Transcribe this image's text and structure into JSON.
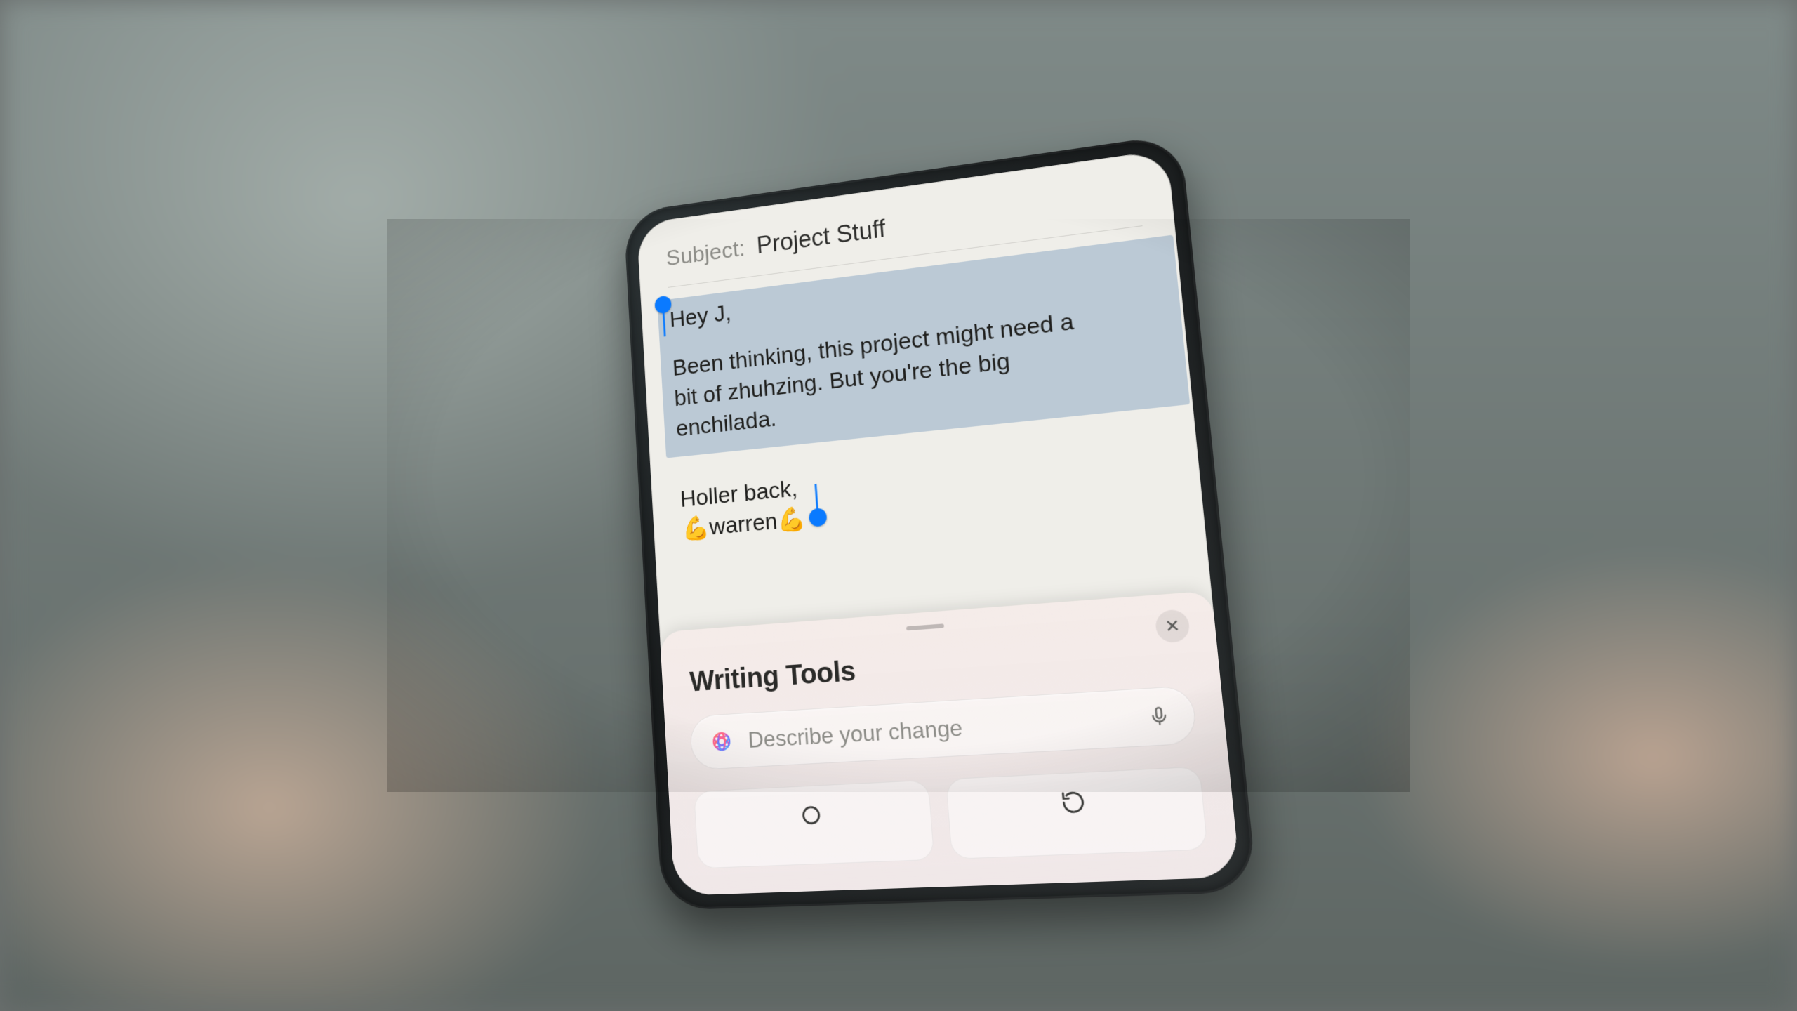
{
  "compose": {
    "subject_label": "Subject:",
    "subject_value": "Project Stuff",
    "greeting": "Hey J,",
    "paragraph": "Been thinking, this project might need a bit of zhuhzing. But you're the big enchilada.",
    "signoff": "Holler back,",
    "signature": "💪warren💪"
  },
  "sheet": {
    "title": "Writing Tools",
    "prompt_placeholder": "Describe your change",
    "close_glyph": "✕"
  },
  "icons": {
    "ai": "apple-intelligence-icon",
    "mic": "microphone-icon",
    "rewrite": "rewrite-icon"
  },
  "colors": {
    "selection": "#b6c5d2",
    "handle": "#0a7aff",
    "screen_bg": "#efeee9",
    "muted_text": "#8b8b86"
  }
}
